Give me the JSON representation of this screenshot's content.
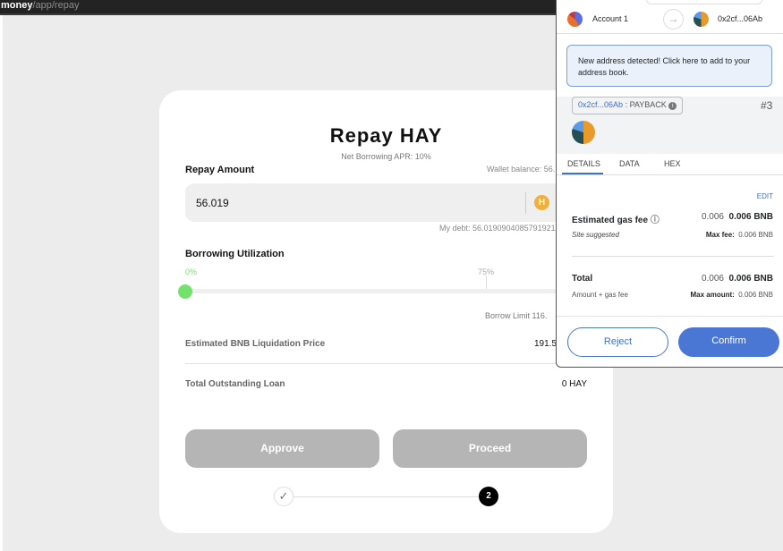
{
  "browser": {
    "url_host": "money",
    "url_path": "/app/repay"
  },
  "card": {
    "title": "Repay HAY",
    "apr": "Net Borrowing APR: 10%",
    "repay_label": "Repay Amount",
    "wallet_balance": "Wallet balance: 56.",
    "amount_value": "56.019",
    "my_debt": "My debt: 56.0190904085791921",
    "utilization_label": "Borrowing Utilization",
    "tick_0": "0%",
    "tick_75": "75%",
    "utilization_percent": 0,
    "borrow_limit": "Borrow Limit 116.",
    "liq_label": "Estimated BNB Liquidation Price",
    "liq_value": "191.5",
    "loan_label": "Total Outstanding Loan",
    "loan_value": "0 HAY",
    "approve": "Approve",
    "proceed": "Proceed",
    "step1_icon": "check-icon",
    "step2": "2",
    "accent": "#72e36a"
  },
  "wallet": {
    "from": "Account 1",
    "to": "0x2cf...06Ab",
    "notice": "New address detected! Click here to add to your address book.",
    "contract": "0x2cf...06Ab",
    "method": ": PAYBACK",
    "nonce": "#3",
    "tabs": [
      "DETAILS",
      "DATA",
      "HEX"
    ],
    "edit": "EDIT",
    "gas_label": "Estimated gas fee",
    "gas_value": "0.006",
    "gas_value_bold": "0.006 BNB",
    "site_suggested": "Site suggested",
    "max_fee_label": "Max fee:",
    "max_fee": "0.006 BNB",
    "total_label": "Total",
    "total_value": "0.006",
    "total_value_bold": "0.006 BNB",
    "amount_gas": "Amount + gas fee",
    "max_amount_label": "Max amount:",
    "max_amount": "0.006 BNB",
    "reject": "Reject",
    "confirm": "Confirm",
    "primary": "#4a76d4"
  }
}
